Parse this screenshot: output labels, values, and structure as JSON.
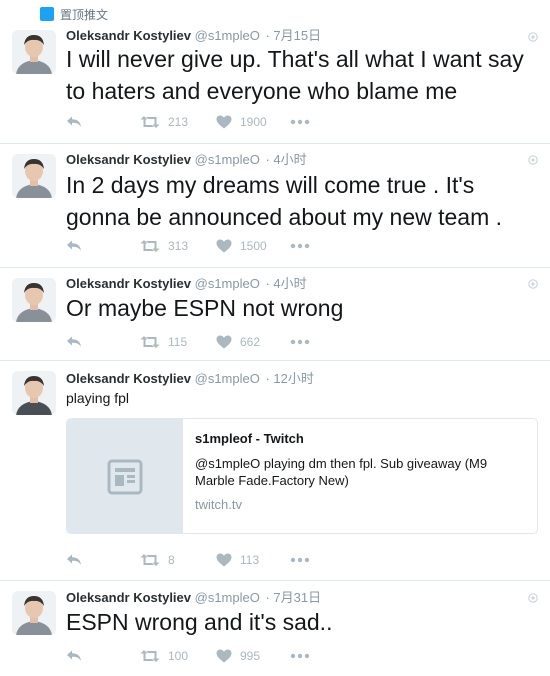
{
  "pinned_label": "置顶推文",
  "colors": {
    "accent": "#1da1f2",
    "meta": "#8899a6",
    "actions": "#aab8c2",
    "divider": "#e1e8ed"
  },
  "tweets": [
    {
      "name": "Oleksandr Kostyliev",
      "handle": "@s1mpleO",
      "time": "· 7月15日",
      "text": "I will never give up. That's all what I want say to haters and everyone who blame me",
      "retweets": "213",
      "likes": "1900"
    },
    {
      "name": "Oleksandr Kostyliev",
      "handle": "@s1mpleO",
      "time": "· 4小时",
      "text": "In 2 days my dreams will come true . It's gonna be announced about my new team .",
      "retweets": "313",
      "likes": "1500"
    },
    {
      "name": "Oleksandr Kostyliev",
      "handle": "@s1mpleO",
      "time": "· 4小时",
      "text": "Or maybe ESPN not wrong",
      "retweets": "115",
      "likes": "662"
    },
    {
      "name": "Oleksandr Kostyliev",
      "handle": "@s1mpleO",
      "time": "· 12小时",
      "text": "playing fpl",
      "retweets": "8",
      "likes": "113",
      "card": {
        "title": "s1mpleof - Twitch",
        "description": "@s1mpleO playing dm then fpl. Sub giveaway (M9 Marble Fade.Factory New)",
        "domain": "twitch.tv"
      }
    },
    {
      "name": "Oleksandr Kostyliev",
      "handle": "@s1mpleO",
      "time": "· 7月31日",
      "text": "ESPN wrong and it's sad..",
      "retweets": "100",
      "likes": "995"
    }
  ]
}
